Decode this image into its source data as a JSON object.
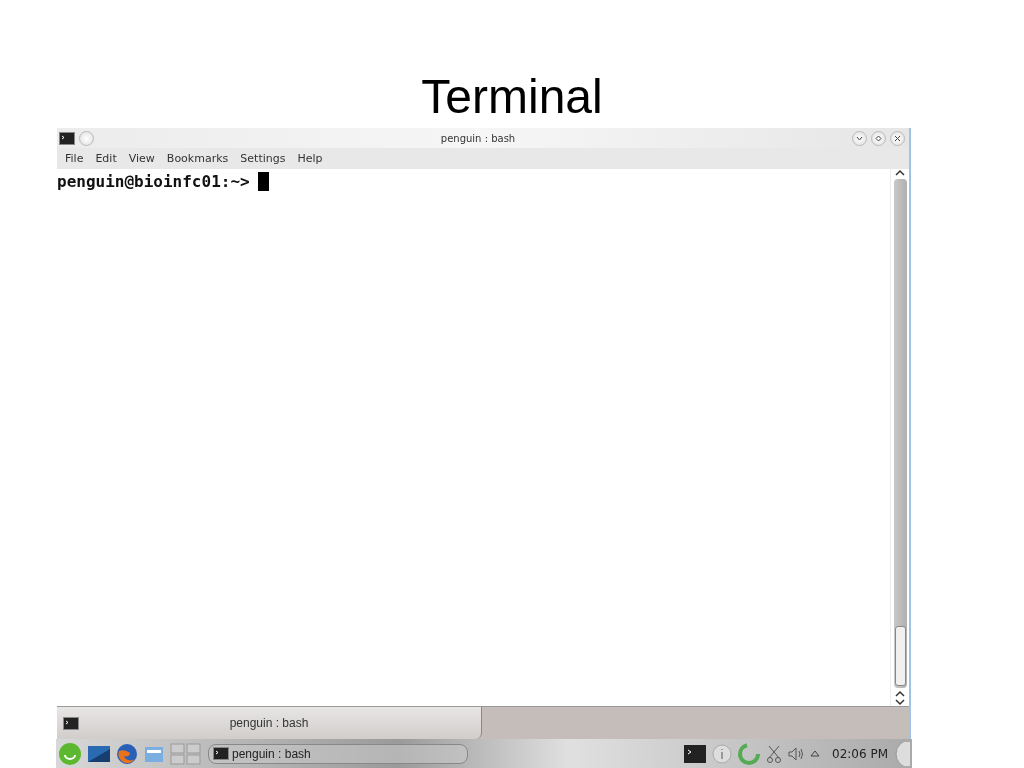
{
  "slide_title": "Terminal",
  "window": {
    "title": "penguin : bash"
  },
  "menu": [
    "File",
    "Edit",
    "View",
    "Bookmarks",
    "Settings",
    "Help"
  ],
  "terminal": {
    "prompt": "penguin@bioinfc01:~>"
  },
  "tabs": [
    {
      "label": "penguin : bash",
      "selected": true
    }
  ],
  "taskbar": {
    "task": "penguin : bash",
    "clock": "02:06 PM"
  }
}
